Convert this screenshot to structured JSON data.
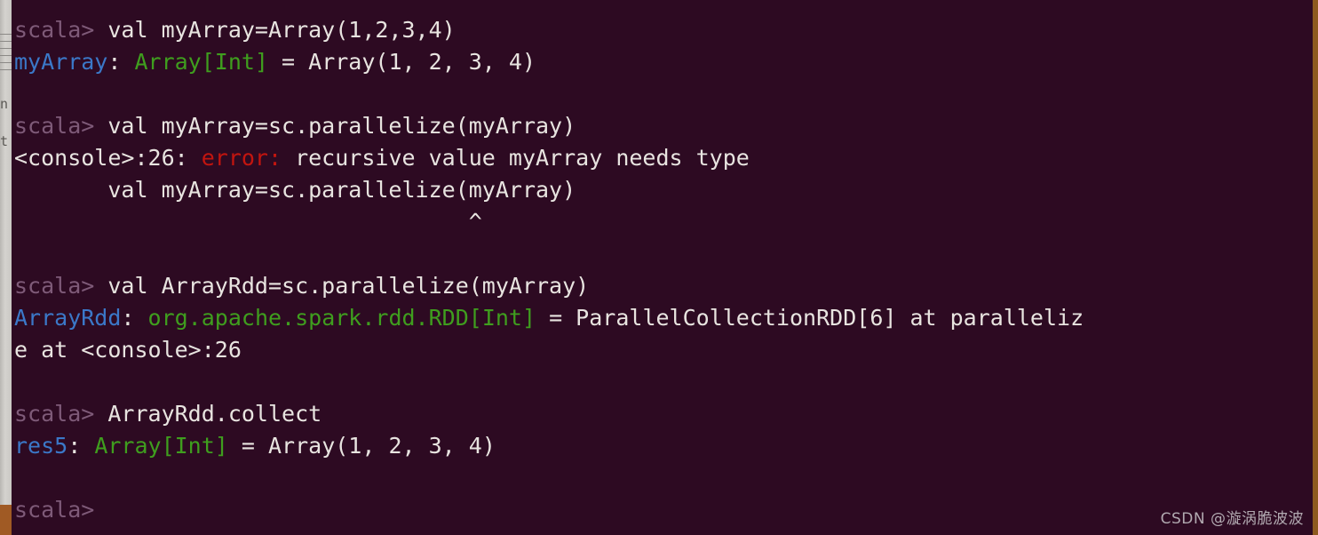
{
  "terminal": {
    "shell": "scala",
    "prompt": "scala>",
    "background_color": "#2d0a22",
    "foreground_color": "#e8e4e0",
    "prompt_color": "#7e5a78",
    "identifier_color": "#3b78c8",
    "type_color": "#3f9e1e",
    "error_color": "#c2150f",
    "window_border_color": "#8d5a1f",
    "lines": [
      {
        "id": "cmd-1",
        "kind": "command",
        "prompt": "scala> ",
        "text": "val myArray=Array(1,2,3,4)"
      },
      {
        "id": "out-1",
        "kind": "result",
        "ident": "myArray",
        "colon": ": ",
        "type": "Array[Int]",
        "rest": " = Array(1, 2, 3, 4)"
      },
      {
        "id": "blank-1",
        "kind": "blank",
        "text": ""
      },
      {
        "id": "cmd-2",
        "kind": "command",
        "prompt": "scala> ",
        "text": "val myArray=sc.parallelize(myArray)"
      },
      {
        "id": "out-2",
        "kind": "error",
        "location": "<console>:26: ",
        "label": "error:",
        "message": " recursive value myArray needs type"
      },
      {
        "id": "out-3",
        "kind": "plain",
        "text": "       val myArray=sc.parallelize(myArray)"
      },
      {
        "id": "out-4",
        "kind": "plain",
        "text": "                                  ^"
      },
      {
        "id": "blank-2",
        "kind": "blank",
        "text": ""
      },
      {
        "id": "cmd-3",
        "kind": "command",
        "prompt": "scala> ",
        "text": "val ArrayRdd=sc.parallelize(myArray)"
      },
      {
        "id": "out-5",
        "kind": "result",
        "ident": "ArrayRdd",
        "colon": ": ",
        "type": "org.apache.spark.rdd.RDD[Int]",
        "rest": " = ParallelCollectionRDD[6] at paralleliz"
      },
      {
        "id": "out-6",
        "kind": "plain",
        "text": "e at <console>:26"
      },
      {
        "id": "blank-3",
        "kind": "blank",
        "text": ""
      },
      {
        "id": "cmd-4",
        "kind": "command",
        "prompt": "scala> ",
        "text": "ArrayRdd.collect"
      },
      {
        "id": "out-7",
        "kind": "result",
        "ident": "res5",
        "colon": ": ",
        "type": "Array[Int]",
        "rest": " = Array(1, 2, 3, 4)"
      },
      {
        "id": "blank-4",
        "kind": "blank",
        "text": ""
      },
      {
        "id": "cmd-5",
        "kind": "command",
        "prompt": "scala>",
        "text": ""
      }
    ]
  },
  "edge": {
    "glyph_top": "n",
    "glyph_bottom": "t"
  },
  "watermark": {
    "text": "CSDN @漩涡脆波波"
  }
}
